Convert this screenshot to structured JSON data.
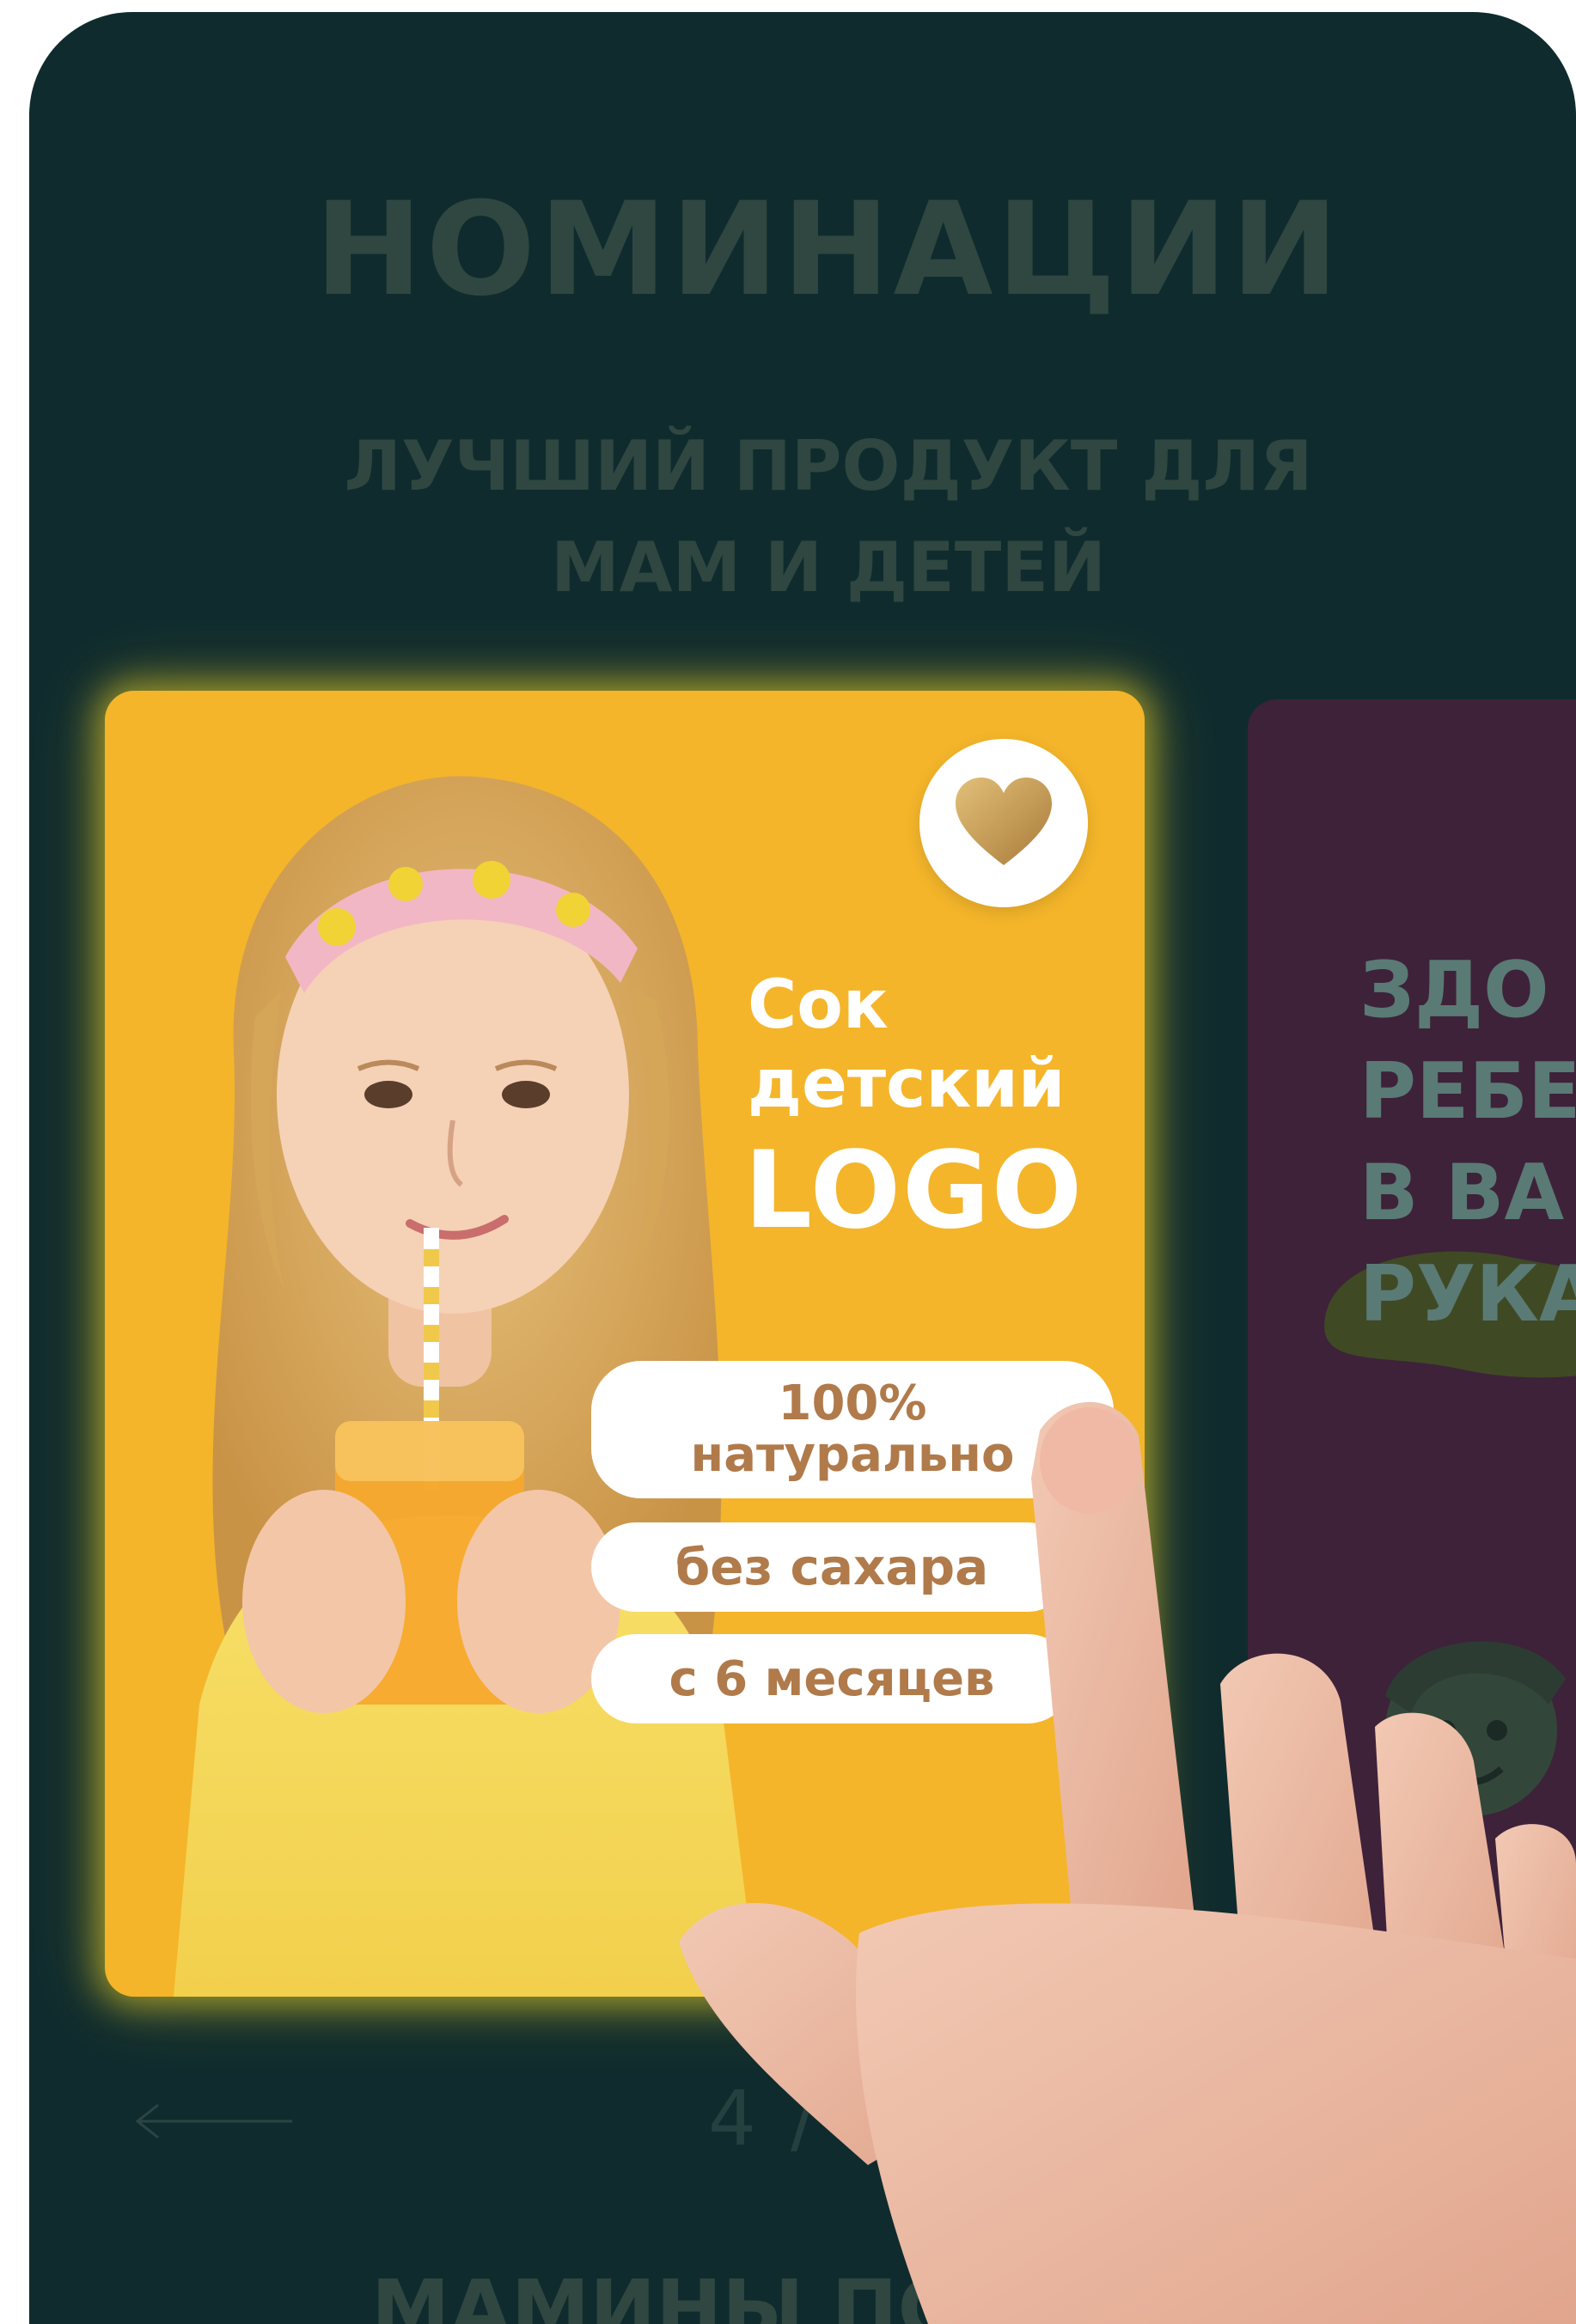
{
  "page": {
    "heading": "НОМИНАЦИИ",
    "subheading_line1": "ЛУЧШИЙ ПРОДУКТ ДЛЯ",
    "subheading_line2": "МАМ И ДЕТЕЙ"
  },
  "card_main": {
    "product_line1": "Сок",
    "product_line2": "детский",
    "logo": "LOGO",
    "pill1_line1": "100%",
    "pill1_line2": "натурально",
    "pill2": "без сахара",
    "pill3": "с 6 месяцев",
    "icon": "heart-icon"
  },
  "card_next": {
    "title": "ЗДО\nРЕБЕ\nВ ВА\nРУКА"
  },
  "pager": {
    "text": "4 / 10"
  },
  "bottom": {
    "title": "МАМИНЫ ПО"
  },
  "colors": {
    "background": "#0f2b2e",
    "card_main": "#f4b52a",
    "card_next": "#3e2239",
    "pill_text": "#b07a4a",
    "muted_text": "#2f4740",
    "heart_gold": "#c9a056"
  },
  "icons": {
    "prev_arrow": "arrow-left-icon",
    "badge": "heart-icon"
  }
}
